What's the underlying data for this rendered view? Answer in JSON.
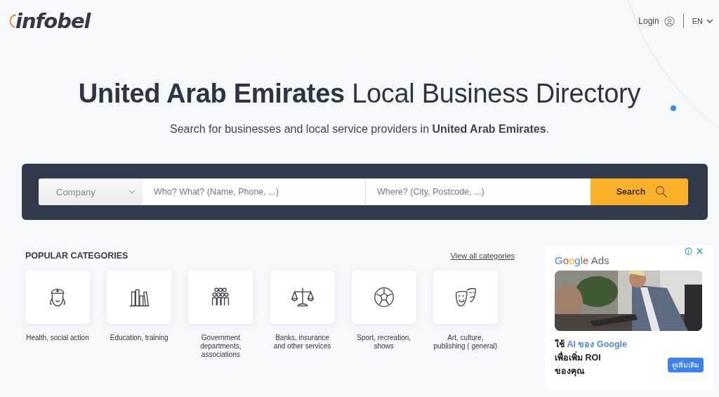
{
  "header": {
    "logo": "infobel",
    "login": "Login",
    "language": "EN"
  },
  "hero": {
    "title": "**United Arab Emirates** Local Business Directory",
    "subtitle": "Search for businesses and local service providers in **United Arab Emirates**."
  },
  "search": {
    "type_select": "Company",
    "who": {
      "placeholder": "Who? What? (Name, Phone, ...)"
    },
    "where": {
      "placeholder": "Where? (City, Postcode, ...)"
    },
    "button": "Search"
  },
  "categories": {
    "title": "POPULAR CATEGORIES",
    "view_all": "View all categories",
    "items": [
      {
        "kind": "health",
        "label": "Health, social action"
      },
      {
        "kind": "education",
        "label": "Education, training"
      },
      {
        "kind": "government",
        "label": "Government departments, associations"
      },
      {
        "kind": "banks",
        "label": "Banks, insurance and other services"
      },
      {
        "kind": "sport",
        "label": "Sport, recreation, shows"
      },
      {
        "kind": "art",
        "label": "Art, culture, publishing ( general)"
      }
    ]
  },
  "ad": {
    "brand": "Google Ads",
    "image": {
      "kind": "picture"
    },
    "headline": [
      [
        {
          "text": "ใช้ ",
          "highlight": false
        },
        {
          "text": "AI ของ Google",
          "highlight": true
        }
      ],
      [
        {
          "text": "เพื่อเพิ่ม ROI",
          "highlight": false
        }
      ],
      [
        {
          "text": "ของคุณ",
          "highlight": false
        }
      ]
    ],
    "button": "ดูเพิ่มเติม"
  }
}
